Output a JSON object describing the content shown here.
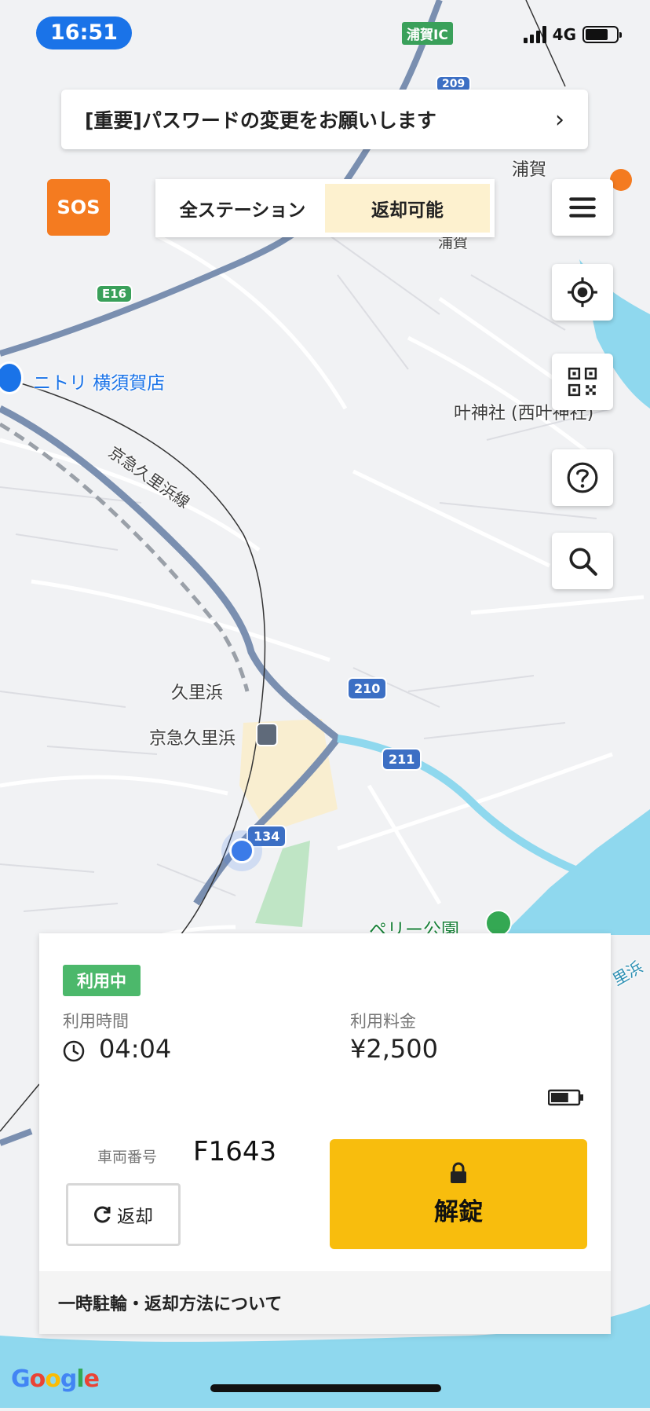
{
  "status_bar": {
    "time": "16:51",
    "network": "4G"
  },
  "map": {
    "labels": {
      "uraga_ic": "浦賀IC",
      "route_209": "209",
      "uraga_station": "浦賀",
      "uraga_area": "浦賀",
      "e16": "E16",
      "nitori": "ニトリ 横須賀店",
      "kanou_shrine": "叶神社 (西叶神社)",
      "keikyu_line": "京急久里浜線",
      "kurihama_jr": "久里浜",
      "keikyu_kurihama": "京急久里浜",
      "route_210": "210",
      "route_211": "211",
      "route_134": "134",
      "perry_park": "ペリー公園",
      "coast_road": "ク里浜"
    }
  },
  "notice": {
    "text": "[重要]パスワードの変更をお願いします",
    "arrow": "›"
  },
  "sos": {
    "label": "SOS"
  },
  "filter": {
    "all": "全ステーション",
    "returnable": "返却可能",
    "selected": "returnable"
  },
  "fabs": [
    "menu-icon",
    "locate-icon",
    "qr-icon",
    "help-icon",
    "search-icon"
  ],
  "rental": {
    "status": "利用中",
    "time_label": "利用時間",
    "time_value": "04:04",
    "fee_label": "利用料金",
    "fee_value": "¥2,500",
    "vehicle_label": "車両番号",
    "vehicle_number": "F1643",
    "battery_level": 0.66,
    "return_label": "返却",
    "unlock_label": "解錠",
    "footer": "一時駐輪・返却方法について"
  },
  "attribution": "Google",
  "colors": {
    "accent": "#f8bd0d",
    "sos": "#f47b20",
    "status_green": "#4cb86b",
    "water": "#8fd8ee",
    "highway": "#7a8fb0"
  }
}
